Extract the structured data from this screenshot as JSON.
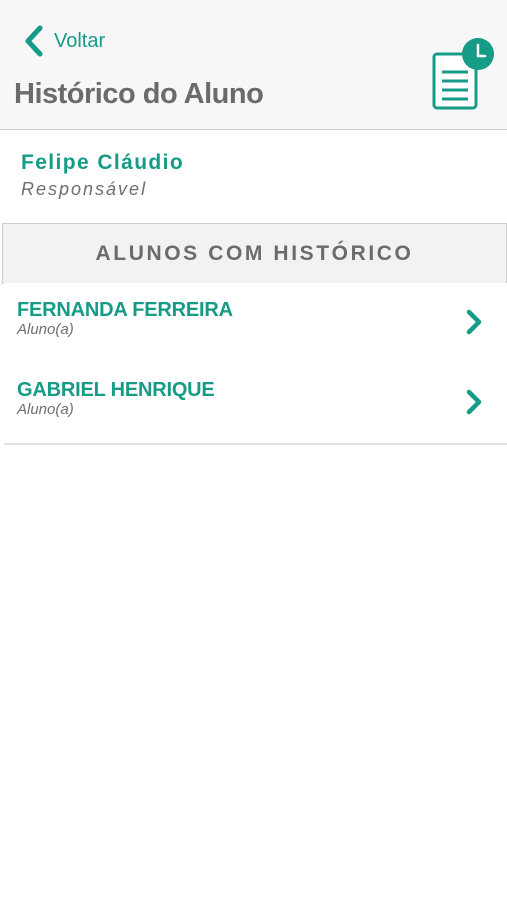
{
  "header": {
    "back_label": "Voltar",
    "title": "Histórico do Aluno",
    "icon": "document-clock-icon"
  },
  "guardian": {
    "name": "Felipe Cláudio",
    "role": "Responsável"
  },
  "section": {
    "title": "ALUNOS COM HISTÓRICO"
  },
  "students": [
    {
      "name": "FERNANDA FERREIRA",
      "role": "Aluno(a)"
    },
    {
      "name": "GABRIEL HENRIQUE",
      "role": "Aluno(a)"
    }
  ],
  "colors": {
    "accent": "#159b86",
    "text_gray": "#6b6b6b",
    "header_bg": "#f7f7f7"
  }
}
